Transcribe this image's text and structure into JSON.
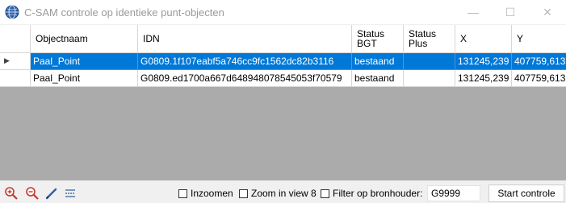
{
  "window": {
    "title": "C-SAM controle op identieke punt-objecten",
    "minimize_label": "—",
    "maximize_label": "☐",
    "close_label": "✕"
  },
  "grid": {
    "columns": [
      "Objectnaam",
      "IDN",
      "Status BGT",
      "Status Plus",
      "X",
      "Y"
    ],
    "rows": [
      {
        "objectnaam": "Paal_Point",
        "idn": "G0809.1f107eabf5a746cc9fc1562dc82b3116",
        "status_bgt": "bestaand",
        "status_plus": "",
        "x": "131245,239",
        "y": "407759,613",
        "selected": true
      },
      {
        "objectnaam": "Paal_Point",
        "idn": "G0809.ed1700a667d648948078545053f70579",
        "status_bgt": "bestaand",
        "status_plus": "",
        "x": "131245,239",
        "y": "407759,613",
        "selected": false
      }
    ],
    "selected_row_indicator": "▶"
  },
  "toolbar": {
    "icons": [
      "zoom-in-icon",
      "zoom-out-icon",
      "pencil-icon",
      "list-icon"
    ],
    "inzoomen_label": "Inzoomen",
    "inzoomen_checked": false,
    "zoom_view_label": "Zoom in view 8",
    "zoom_view_checked": false,
    "filter_label": "Filter op bronhouder:",
    "filter_checked": false,
    "filter_value": "G9999",
    "start_label": "Start controle"
  },
  "colors": {
    "selection": "#0078d7",
    "grid_background": "#ababab"
  }
}
